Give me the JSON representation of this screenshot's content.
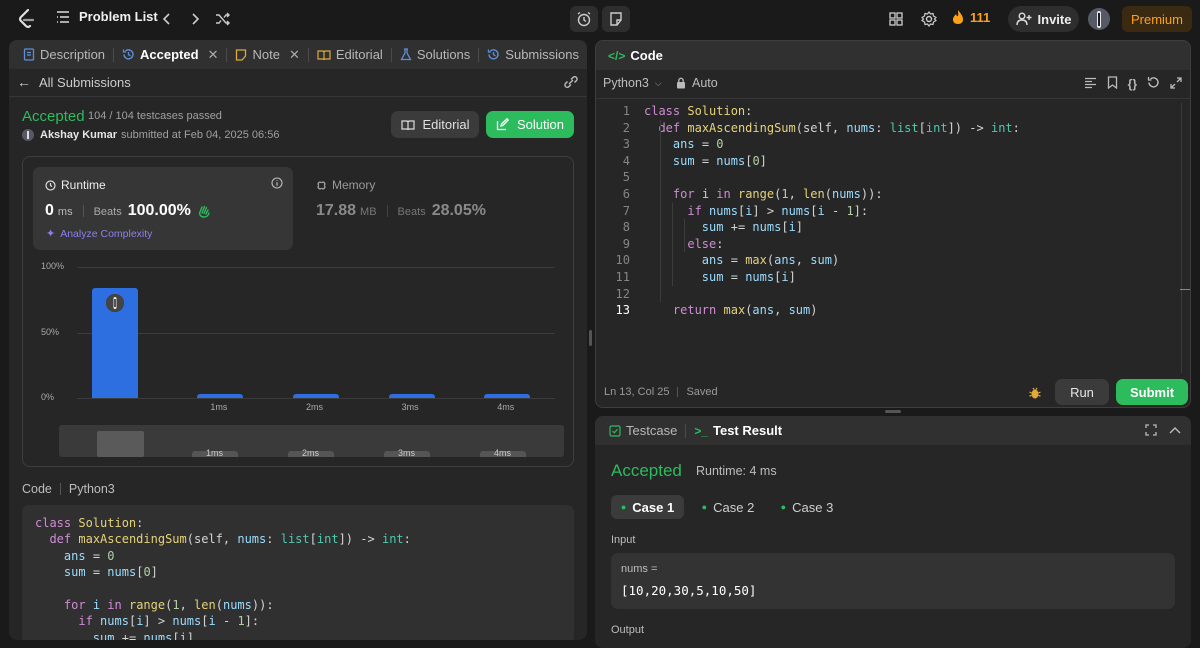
{
  "topbar": {
    "problem_list": "Problem List",
    "streak": "111",
    "invite": "Invite",
    "premium": "Premium"
  },
  "left_tabs": [
    {
      "label": "Description"
    },
    {
      "label": "Accepted"
    },
    {
      "label": "Note"
    },
    {
      "label": "Editorial"
    },
    {
      "label": "Solutions"
    },
    {
      "label": "Submissions"
    }
  ],
  "submission": {
    "back_label": "All Submissions",
    "status": "Accepted",
    "testcases": "104 / 104 testcases passed",
    "user": "Akshay Kumar",
    "submitted": "submitted at Feb 04, 2025 06:56",
    "editorial_btn": "Editorial",
    "solution_btn": "Solution"
  },
  "runtime": {
    "title": "Runtime",
    "value": "0",
    "unit": "ms",
    "beats_label": "Beats",
    "beats": "100.00%",
    "analyze": "Analyze Complexity"
  },
  "memory": {
    "title": "Memory",
    "value": "17.88",
    "unit": "MB",
    "beats_label": "Beats",
    "beats": "28.05%"
  },
  "chart_data": {
    "type": "bar",
    "categories": [
      "",
      "1ms",
      "2ms",
      "3ms",
      "4ms"
    ],
    "values": [
      84,
      2,
      2,
      2,
      2
    ],
    "ylim": [
      0,
      100
    ],
    "yticks": [
      "100%",
      "50%",
      "0%"
    ],
    "grid": true,
    "mini_labels": [
      "1ms",
      "2ms",
      "3ms",
      "4ms"
    ]
  },
  "code_section": {
    "label": "Code",
    "lang": "Python3"
  },
  "left_code": [
    "class Solution:",
    "  def maxAscendingSum(self, nums: list[int]) -> int:",
    "    ans = 0",
    "    sum = nums[0]",
    "",
    "    for i in range(1, len(nums)):",
    "      if nums[i] > nums[i - 1]:",
    "        sum += nums[i]"
  ],
  "editor": {
    "title": "Code",
    "lang": "Python3",
    "mode": "Auto",
    "status_pos": "Ln 13, Col 25",
    "status_saved": "Saved",
    "run": "Run",
    "submit": "Submit",
    "line_numbers": [
      "1",
      "2",
      "3",
      "4",
      "5",
      "6",
      "7",
      "8",
      "9",
      "10",
      "11",
      "12",
      "13"
    ],
    "lines": [
      "class Solution:",
      "  def maxAscendingSum(self, nums: list[int]) -> int:",
      "    ans = 0",
      "    sum = nums[0]",
      "",
      "    for i in range(1, len(nums)):",
      "      if nums[i] > nums[i - 1]:",
      "        sum += nums[i]",
      "      else:",
      "        ans = max(ans, sum)",
      "        sum = nums[i]",
      "",
      "    return max(ans, sum)"
    ]
  },
  "result": {
    "tab_testcase": "Testcase",
    "tab_result": "Test Result",
    "status": "Accepted",
    "runtime": "Runtime: 4 ms",
    "cases": [
      "Case 1",
      "Case 2",
      "Case 3"
    ],
    "input_label": "Input",
    "var_name": "nums =",
    "var_value": "[10,20,30,5,10,50]",
    "output_label": "Output"
  },
  "colors": {
    "accent_green": "#2cbb5d",
    "bar_blue": "#2d6fe0",
    "streak_orange": "#ffa116",
    "premium": "#ffa116"
  }
}
